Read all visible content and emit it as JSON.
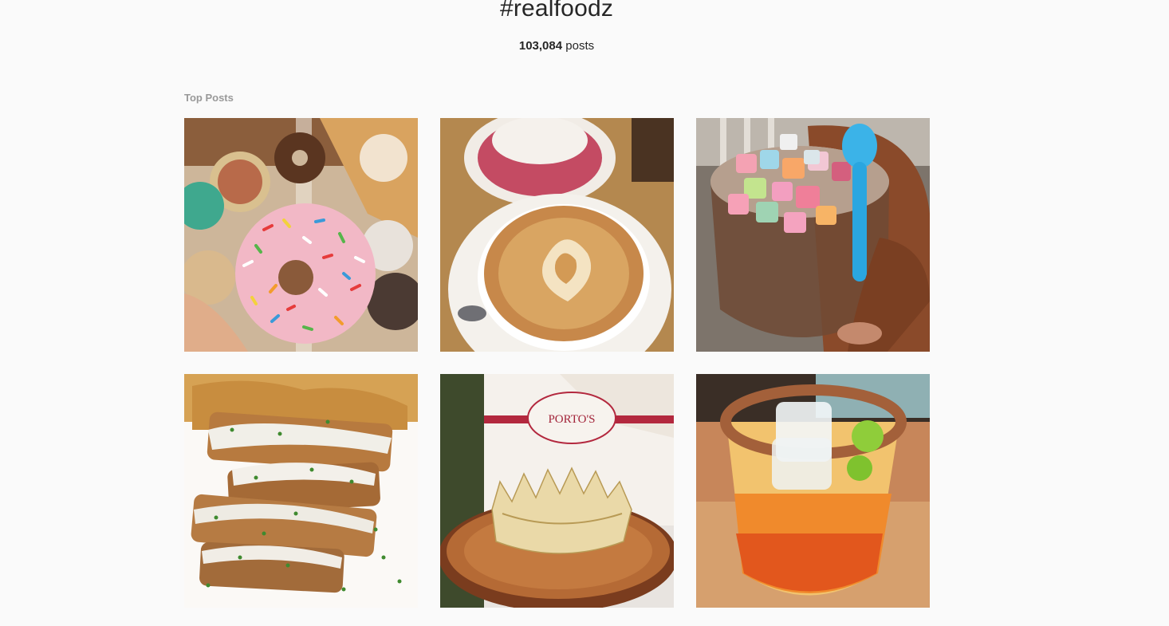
{
  "header": {
    "hashtag": "#realfoodz",
    "post_count": "103,084",
    "post_count_suffix": " posts"
  },
  "sections": {
    "top_posts_label": "Top Posts"
  },
  "posts": [
    {
      "subject": "sprinkle-donut"
    },
    {
      "subject": "latte-art"
    },
    {
      "subject": "marshmallow-cereal-cup"
    },
    {
      "subject": "glazed-toast-stack"
    },
    {
      "subject": "portos-king-cake",
      "printed_text": "PORTO'S"
    },
    {
      "subject": "chili-rim-cocktail"
    }
  ],
  "colors": {
    "background": "#fafafa",
    "text": "#262626",
    "muted": "#999999"
  }
}
